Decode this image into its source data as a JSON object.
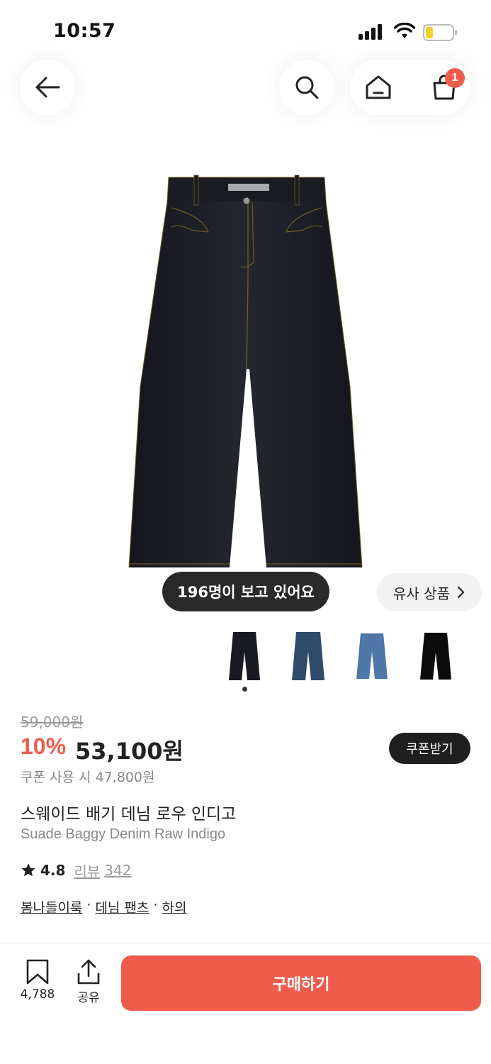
{
  "status_bar": {
    "time": "10:57"
  },
  "header": {
    "cart_badge": "1"
  },
  "product": {
    "viewers_text": "196명이 보고 있어요",
    "similar_label": "유사 상품",
    "original_price": "59,000원",
    "discount": "10%",
    "price": "53,100원",
    "coupon_button": "쿠폰받기",
    "coupon_price": "쿠폰 사용 시 47,800원",
    "title_kr": "스웨이드 배기 데님 로우 인디고",
    "title_en": "Suade Baggy Denim Raw Indigo",
    "rating": "4.8",
    "review_label": "리뷰",
    "review_count": "342",
    "breadcrumbs": [
      "봄나들이룩",
      "데님 팬츠",
      "하의"
    ],
    "breadcrumb_sep": "·",
    "thumbnails": [
      "raw-indigo",
      "mid-blue",
      "light-blue",
      "black"
    ]
  },
  "bottom_bar": {
    "wish_count": "4,788",
    "share_label": "공유",
    "buy_label": "구매하기"
  },
  "colors": {
    "accent": "#ef5c4c",
    "dark": "#1f1f1f"
  }
}
